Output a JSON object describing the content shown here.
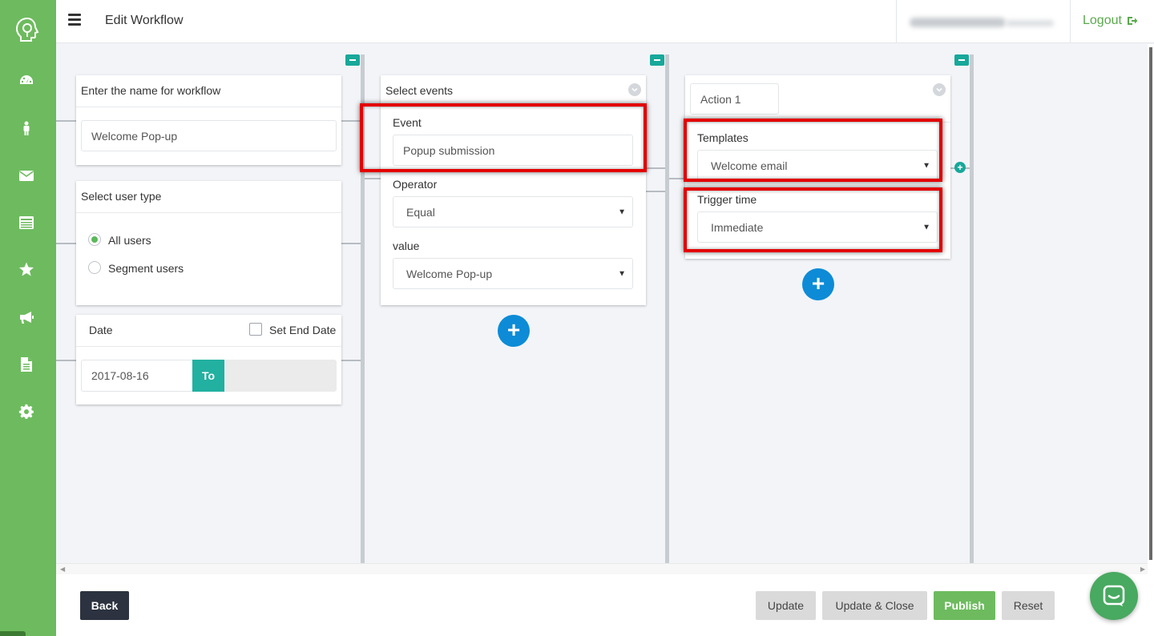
{
  "header": {
    "title": "Edit Workflow",
    "logout_label": "Logout"
  },
  "sidebar": {
    "items": [
      "dashboard-icon",
      "user-icon",
      "mail-icon",
      "list-icon",
      "star-icon",
      "megaphone-icon",
      "document-icon",
      "gear-icon"
    ]
  },
  "workflow_card": {
    "title": "Enter the name for workflow",
    "name_value": "Welcome Pop-up"
  },
  "user_type_card": {
    "title": "Select user type",
    "options": [
      "All users",
      "Segment users"
    ],
    "selected": "All users"
  },
  "date_card": {
    "title": "Date",
    "end_date_label": "Set End Date",
    "start_date": "2017-08-16",
    "to_label": "To"
  },
  "events_card": {
    "title": "Select events",
    "event_label": "Event",
    "event_value": "Popup submission",
    "operator_label": "Operator",
    "operator_value": "Equal",
    "value_label": "value",
    "value_value": "Welcome Pop-up"
  },
  "action_card": {
    "tab_label": "Action 1",
    "templates_label": "Templates",
    "templates_value": "Welcome email",
    "trigger_label": "Trigger time",
    "trigger_value": "Immediate"
  },
  "footer": {
    "back_label": "Back",
    "update_label": "Update",
    "update_close_label": "Update & Close",
    "publish_label": "Publish",
    "reset_label": "Reset"
  },
  "colors": {
    "brand_green": "#6dbb5e",
    "teal": "#17a89a",
    "blue": "#0d8bd6",
    "highlight_red": "#e40000"
  }
}
